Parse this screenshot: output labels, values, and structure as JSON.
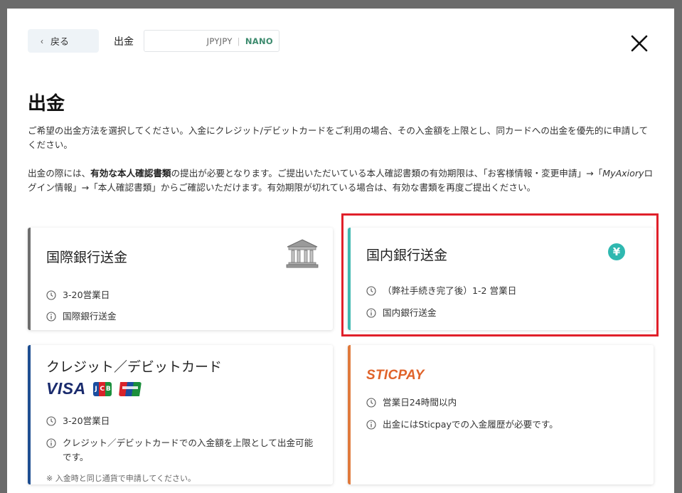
{
  "header": {
    "back_label": "戻る",
    "title": "出金",
    "account_currency": "JPYJPY",
    "account_type": "NANO"
  },
  "page": {
    "title": "出金",
    "description_1": "ご希望の出金方法を選択してください。入金にクレジット/デビットカードをご利用の場合、その入金額を上限とし、同カードへの出金を優先的に申請してください。",
    "description_2_part1": "出金の際には、",
    "description_2_bold": "有効な本人確認書類",
    "description_2_part2": "の提出が必要となります。ご提出いただいている本人確認書類の有効期限は、「お客様情報・変更申請」→「",
    "description_2_italic": "MyAxiory",
    "description_2_part3": "ログイン情報」→「本人確認書類」からご確認いただけます。有効期限が切れている場合は、有効な書類を再度ご提出ください。"
  },
  "methods": [
    {
      "title": "国際銀行送金",
      "time": "3-20営業日",
      "info": "国際銀行送金",
      "icon": "bank-icon"
    },
    {
      "title": "国内銀行送金",
      "time": "（弊社手続き完了後）1-2 営業日",
      "info": "国内銀行送金",
      "icon": "yen-icon",
      "yen_symbol": "¥"
    },
    {
      "title": "クレジット／デビットカード",
      "time": "3-20営業日",
      "info": "クレジット／デビットカードでの入金額を上限として出金可能です。",
      "note": "※ 入金時と同じ通貨で申請してください。",
      "logos": {
        "visa": "VISA",
        "jcb": [
          "J",
          "C",
          "B"
        ]
      }
    },
    {
      "title": "STICPAY",
      "time": "営業日24時間以内",
      "info": "出金にはSticpayでの入金履歴が必要です。"
    }
  ],
  "colors": {
    "international_accent": "#6e6e6e",
    "domestic_accent": "#3fb8b0",
    "card_accent": "#1e4e91",
    "sticpay_accent": "#e07a3c",
    "highlight": "#e0202a"
  }
}
